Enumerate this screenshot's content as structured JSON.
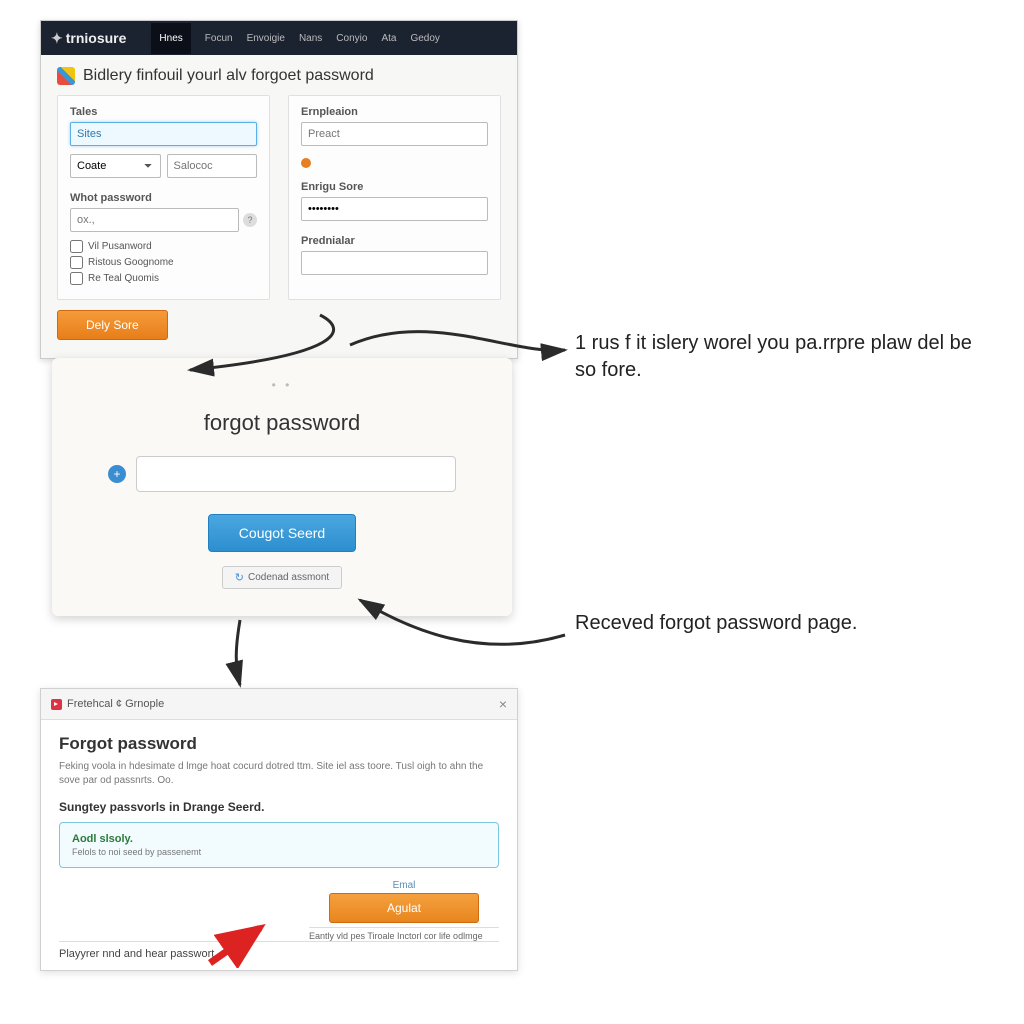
{
  "panel1": {
    "brand": "trniosure",
    "nav": [
      "Hnes",
      "Focun",
      "Envoigie",
      "Nans",
      "Conyio",
      "Ata",
      "Gedoy"
    ],
    "title": "Bidlery finfouil yourl alv forgoet password",
    "left": {
      "label_tales": "Tales",
      "select_tales": "Sites",
      "select_coate": "Coate",
      "input_salococ": "Salococ",
      "label_whotpw": "Whot password",
      "input_whotpw": "ox.,",
      "cb1": "Vil Pusanword",
      "cb2": "Ristous Goognome",
      "cb3": "Re Teal Quomis"
    },
    "right": {
      "label_ernp": "Ernpleaion",
      "input_preact": "Preact",
      "label_enrigu": "Enrigu Sore",
      "input_enrigu": "••••••••",
      "label_pred": "Prednialar"
    },
    "btn": "Dely Sore"
  },
  "panel2": {
    "title": "forgot password",
    "btn_primary": "Cougot Seerd",
    "btn_secondary": "Codenad assmont"
  },
  "panel3": {
    "tab": "Fretehcal ¢ Grnople",
    "title": "Forgot password",
    "desc": "Feking voola in hdesimate d lmge hoat cocurd dotred ttm. Site iel ass toore. Tusl oigh to ahn the sove par od passnrts. Oo.",
    "sub": "Sungtey passvorls in Drange Seerd.",
    "info_title": "Aodl slsoly.",
    "info_sub": "Felols to noi seed by passenemt",
    "email_label": "Emal",
    "btn": "Agulat",
    "small1": "Eantly vld pes Tiroale Inctorl cor life odlmge",
    "bottom": "Playyrer nnd and hear passwort"
  },
  "annot1": "1 rus f it islery worel you pa.rrpre plaw del be so fore.",
  "annot2": "Receved  forgot password page."
}
